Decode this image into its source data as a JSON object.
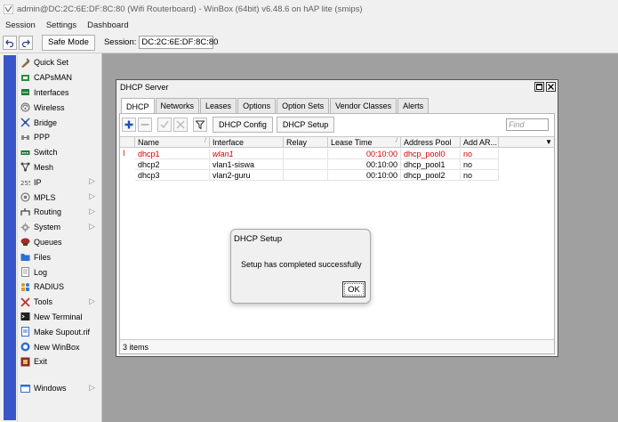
{
  "window": {
    "title": "admin@DC:2C:6E:DF:8C:80 (Wifi Routerboard) - WinBox (64bit) v6.48.6 on hAP lite (smips)"
  },
  "menu": [
    "Session",
    "Settings",
    "Dashboard"
  ],
  "toolbar": {
    "undo_icon": "undo-icon",
    "redo_icon": "redo-icon",
    "safe_mode_label": "Safe Mode",
    "session_label": "Session:",
    "session_value": "DC:2C:6E:DF:8C:80"
  },
  "sidebar": {
    "items": [
      {
        "label": "Quick Set",
        "icon": "quickset-icon",
        "submenu": false
      },
      {
        "label": "CAPsMAN",
        "icon": "capsman-icon",
        "submenu": false
      },
      {
        "label": "Interfaces",
        "icon": "interfaces-icon",
        "submenu": false
      },
      {
        "label": "Wireless",
        "icon": "wireless-icon",
        "submenu": false
      },
      {
        "label": "Bridge",
        "icon": "bridge-icon",
        "submenu": false
      },
      {
        "label": "PPP",
        "icon": "ppp-icon",
        "submenu": false
      },
      {
        "label": "Switch",
        "icon": "switch-icon",
        "submenu": false
      },
      {
        "label": "Mesh",
        "icon": "mesh-icon",
        "submenu": false
      },
      {
        "label": "IP",
        "icon": "ip-icon",
        "submenu": true
      },
      {
        "label": "MPLS",
        "icon": "mpls-icon",
        "submenu": true
      },
      {
        "label": "Routing",
        "icon": "routing-icon",
        "submenu": true
      },
      {
        "label": "System",
        "icon": "system-icon",
        "submenu": true
      },
      {
        "label": "Queues",
        "icon": "queues-icon",
        "submenu": false
      },
      {
        "label": "Files",
        "icon": "files-icon",
        "submenu": false
      },
      {
        "label": "Log",
        "icon": "log-icon",
        "submenu": false
      },
      {
        "label": "RADIUS",
        "icon": "radius-icon",
        "submenu": false
      },
      {
        "label": "Tools",
        "icon": "tools-icon",
        "submenu": true
      },
      {
        "label": "New Terminal",
        "icon": "terminal-icon",
        "submenu": false
      },
      {
        "label": "Make Supout.rif",
        "icon": "supout-icon",
        "submenu": false
      },
      {
        "label": "New WinBox",
        "icon": "winbox-icon",
        "submenu": false
      },
      {
        "label": "Exit",
        "icon": "exit-icon",
        "submenu": false
      }
    ],
    "windows_label": "Windows",
    "brand_color": "#3a55c9"
  },
  "dhcp_window": {
    "title": "DHCP Server",
    "tabs": [
      "DHCP",
      "Networks",
      "Leases",
      "Options",
      "Option Sets",
      "Vendor Classes",
      "Alerts"
    ],
    "active_tab": "DHCP",
    "buttons": {
      "config": "DHCP Config",
      "setup": "DHCP Setup"
    },
    "find_placeholder": "Find",
    "columns": [
      "Name",
      "Interface",
      "Relay",
      "Lease Time",
      "Address Pool",
      "Add AR..."
    ],
    "rows": [
      {
        "flag": "I",
        "name": "dhcp1",
        "interface": "wlan1",
        "relay": "",
        "lease_time": "00:10:00",
        "address_pool": "dhcp_pool0",
        "add_arp": "no",
        "invalid": true
      },
      {
        "flag": "",
        "name": "dhcp2",
        "interface": "vlan1-siswa",
        "relay": "",
        "lease_time": "00:10:00",
        "address_pool": "dhcp_pool1",
        "add_arp": "no",
        "invalid": false
      },
      {
        "flag": "",
        "name": "dhcp3",
        "interface": "vlan2-guru",
        "relay": "",
        "lease_time": "00:10:00",
        "address_pool": "dhcp_pool2",
        "add_arp": "no",
        "invalid": false
      }
    ],
    "status": "3 items"
  },
  "dialog": {
    "title": "DHCP Setup",
    "message": "Setup has completed successfully",
    "ok_label": "OK"
  },
  "colors": {
    "invalid_row": "#d00000",
    "desktop": "#a0a0a0"
  }
}
